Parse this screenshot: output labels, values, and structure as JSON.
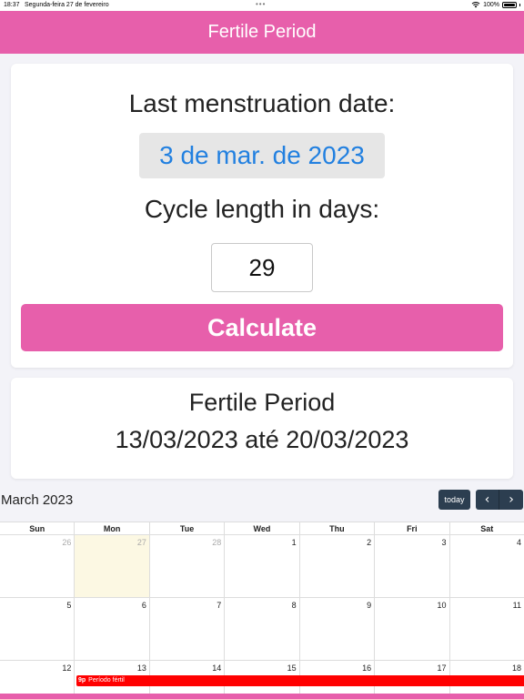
{
  "status_bar": {
    "time": "18:37",
    "date": "Segunda-feira 27 de fevereiro",
    "battery": "100%"
  },
  "header": {
    "title": "Fertile Period"
  },
  "form": {
    "last_date_label": "Last menstruation date:",
    "last_date_value": "3 de mar. de 2023",
    "cycle_label": "Cycle length in days:",
    "cycle_value": "29",
    "calculate_label": "Calculate"
  },
  "result": {
    "title": "Fertile Period",
    "range": "13/03/2023 até 20/03/2023"
  },
  "calendar": {
    "title": "March 2023",
    "today_label": "today",
    "prev_symbol": "‹",
    "next_symbol": "›",
    "weekdays": [
      "Sun",
      "Mon",
      "Tue",
      "Wed",
      "Thu",
      "Fri",
      "Sat"
    ],
    "weeks": [
      [
        "26",
        "27",
        "28",
        "1",
        "2",
        "3",
        "4"
      ],
      [
        "5",
        "6",
        "7",
        "8",
        "9",
        "10",
        "11"
      ],
      [
        "12",
        "13",
        "14",
        "15",
        "16",
        "17",
        "18"
      ]
    ],
    "event": {
      "time": "9p",
      "title": "Período fértil",
      "color": "#ff0000"
    }
  },
  "colors": {
    "accent": "#e75fab",
    "link": "#2280e0",
    "nav_button": "#2c3e50",
    "today_highlight": "#fcf8e3"
  }
}
